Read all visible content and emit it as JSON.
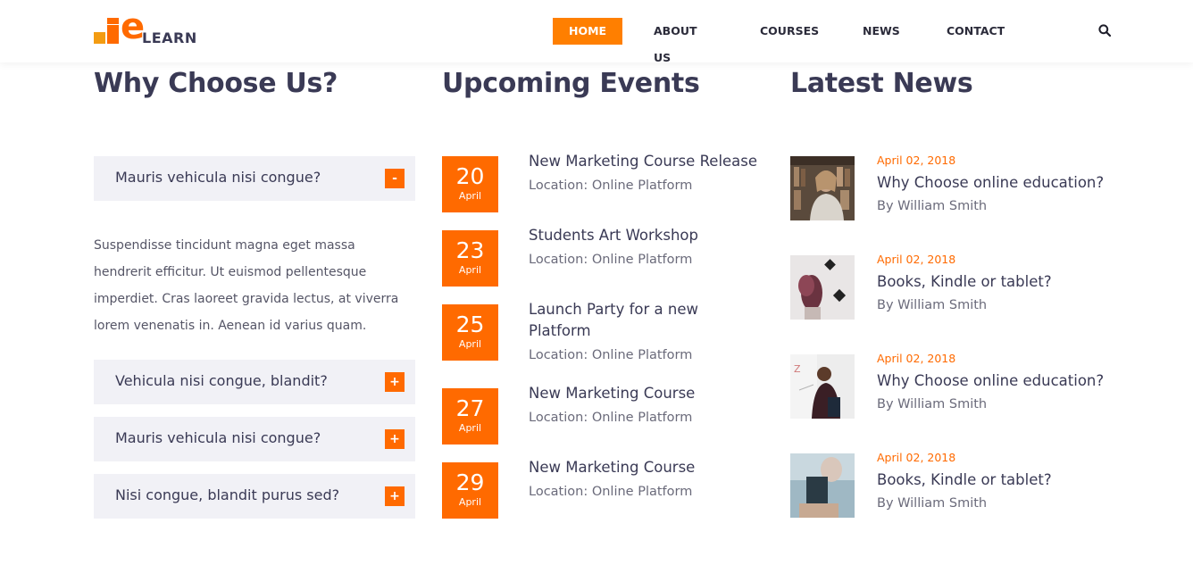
{
  "brand": {
    "logo_letter": "e",
    "logo_word": "LEARN",
    "accent": "#ff6a00"
  },
  "nav": {
    "items": [
      "HOME",
      "ABOUT US",
      "COURSES",
      "NEWS",
      "CONTACT"
    ],
    "active": "HOME",
    "search_icon": "search-icon"
  },
  "why": {
    "title": "Why Choose Us?",
    "items": [
      {
        "question": "Mauris vehicula nisi congue?",
        "toggle": "-",
        "expanded": true
      },
      {
        "question": "Vehicula nisi congue, blandit?",
        "toggle": "+",
        "expanded": false
      },
      {
        "question": "Mauris vehicula nisi congue?",
        "toggle": "+",
        "expanded": false
      },
      {
        "question": "Nisi congue, blandit purus sed?",
        "toggle": "+",
        "expanded": false
      }
    ],
    "answer": "Suspendisse tincidunt magna eget massa hendrerit efficitur. Ut euismod pellentesque imperdiet. Cras laoreet gravida lectus, at viverra lorem venenatis in. Aenean id varius quam."
  },
  "events": {
    "title": "Upcoming Events",
    "items": [
      {
        "day": "20",
        "month": "April",
        "title": "New Marketing Course Release",
        "location": "Location: Online Platform"
      },
      {
        "day": "23",
        "month": "April",
        "title": "Students Art Workshop",
        "location": "Location: Online Platform"
      },
      {
        "day": "25",
        "month": "April",
        "title": "Launch Party for a new Platform",
        "location": "Location: Online Platform"
      },
      {
        "day": "27",
        "month": "April",
        "title": "New Marketing Course",
        "location": "Location: Online Platform"
      },
      {
        "day": "29",
        "month": "April",
        "title": "New Marketing Course",
        "location": "Location: Online Platform"
      }
    ]
  },
  "news": {
    "title": "Latest News",
    "items": [
      {
        "date": "April 02, 2018",
        "title": "Why Choose online education?",
        "author": "By William Smith"
      },
      {
        "date": "April 02, 2018",
        "title": "Books, Kindle or tablet?",
        "author": "By William Smith"
      },
      {
        "date": "April 02, 2018",
        "title": "Why Choose online education?",
        "author": "By William Smith"
      },
      {
        "date": "April 02, 2018",
        "title": "Books, Kindle or tablet?",
        "author": "By William Smith"
      }
    ]
  }
}
